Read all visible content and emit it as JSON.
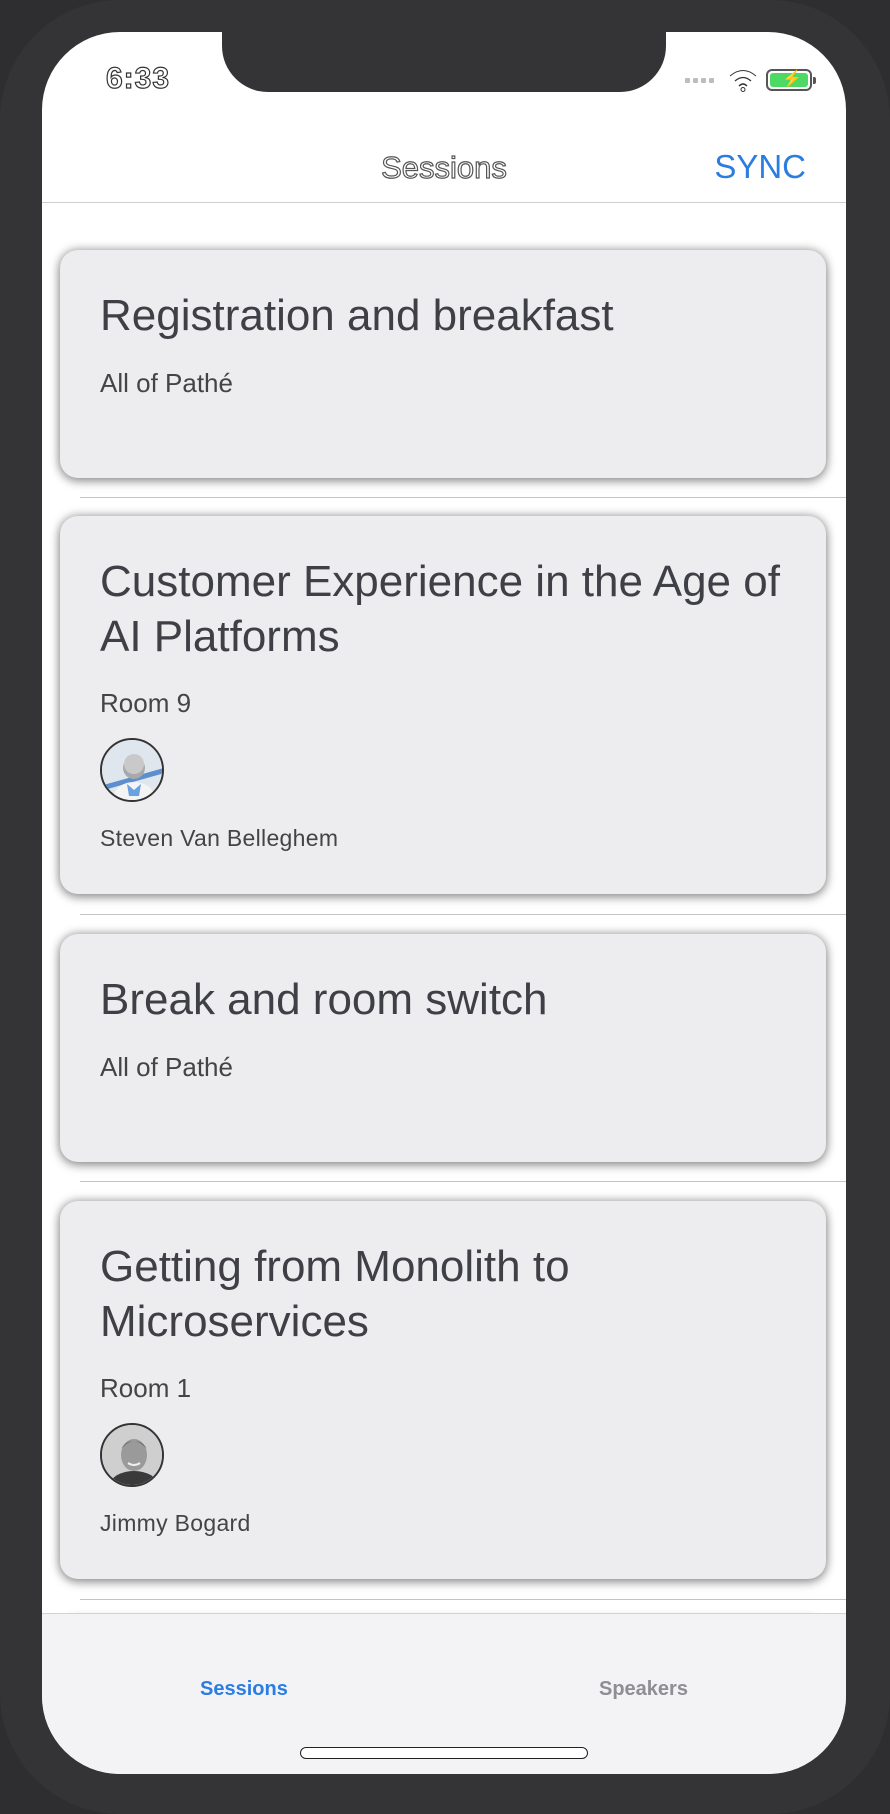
{
  "status_bar": {
    "time": "6:33",
    "icons": [
      "cellular-signal-icon",
      "wifi-icon",
      "battery-charging-icon"
    ]
  },
  "nav": {
    "title": "Sessions",
    "sync_label": "SYNC"
  },
  "sessions": [
    {
      "title": "Registration and breakfast",
      "room": "All of Pathé"
    },
    {
      "title": "Customer Experience in the Age of AI Platforms",
      "room": "Room 9",
      "speaker": "Steven Van Belleghem"
    },
    {
      "title": "Break and room switch",
      "room": "All of Pathé"
    },
    {
      "title": "Getting from Monolith to Microservices",
      "room": "Room 1",
      "speaker": "Jimmy Bogard"
    }
  ],
  "tabs": [
    {
      "label": "Sessions",
      "active": true
    },
    {
      "label": "Speakers",
      "active": false
    }
  ],
  "colors": {
    "accent": "#2b7de1",
    "card_background": "#ededf0",
    "inactive_tab": "#8e8e93"
  }
}
